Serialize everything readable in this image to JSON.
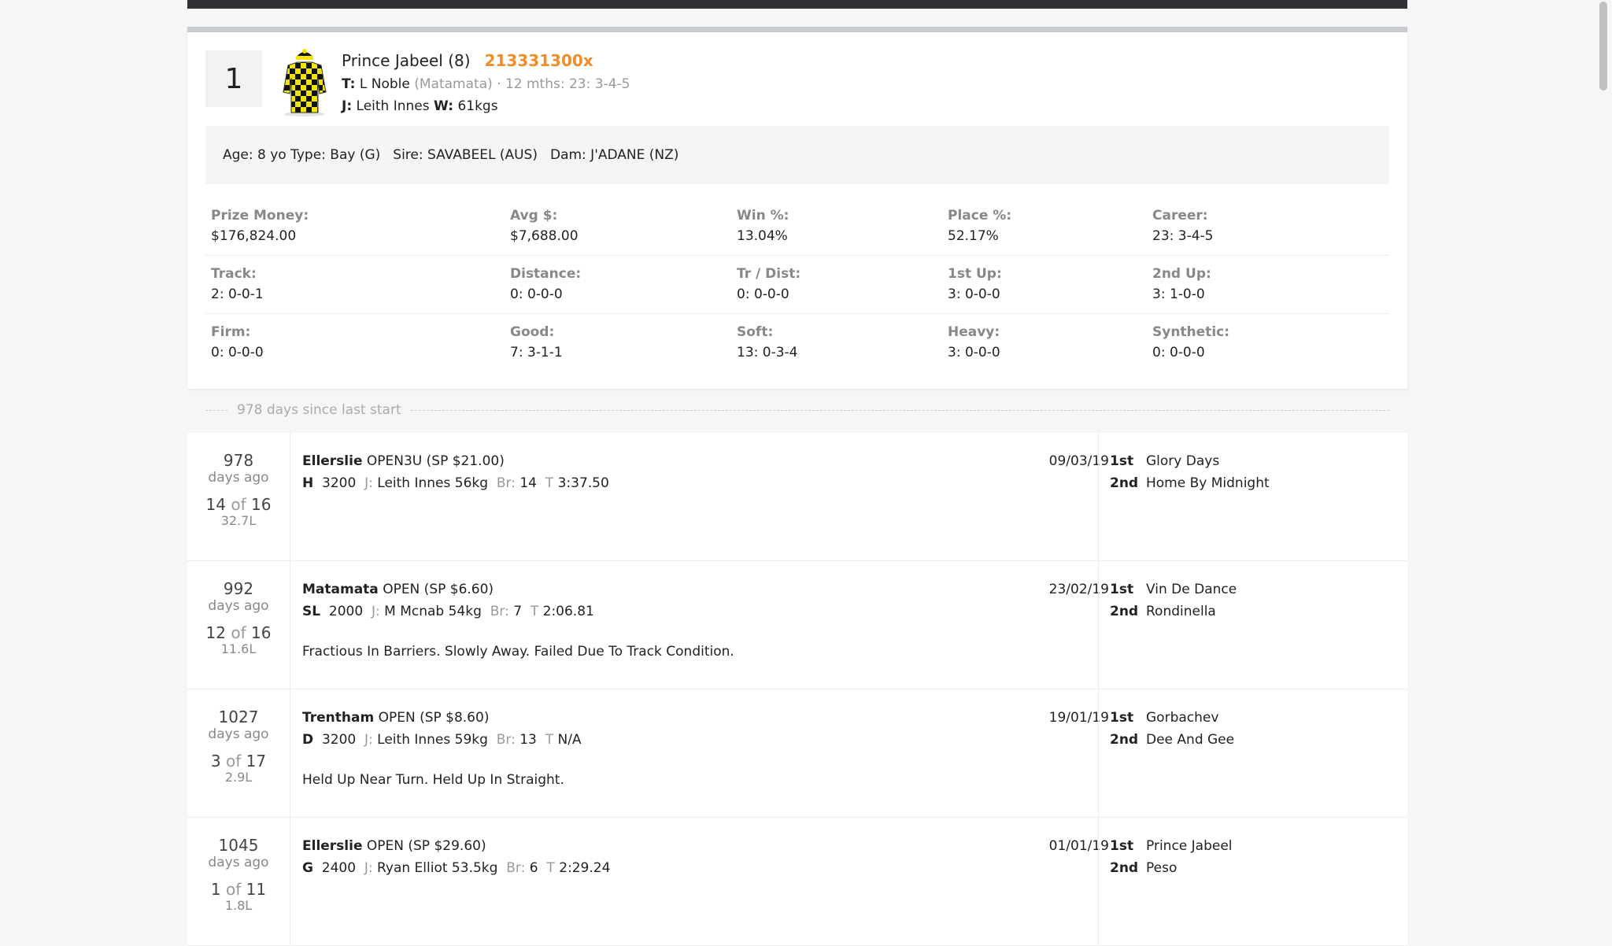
{
  "runner": {
    "number": "1",
    "name": "Prince Jabeel (8)",
    "form": "213331300x",
    "trainer_prefix": "T:",
    "trainer": "L Noble",
    "trainer_location": "(Matamata)",
    "trainer_stats": "· 12 mths: 23: 3-4-5",
    "jockey_prefix": "J:",
    "jockey": "Leith Innes",
    "weight_prefix": "W:",
    "weight": "61kgs"
  },
  "details": {
    "age": "Age: 8 yo",
    "type": "Type: Bay (G)",
    "sire": "Sire: SAVABEEL (AUS)",
    "dam": "Dam: J'ADANE (NZ)"
  },
  "stats": [
    [
      {
        "label": "Prize Money:",
        "value": "$176,824.00"
      },
      {
        "label": "Avg $:",
        "value": "$7,688.00"
      },
      {
        "label": "Win %:",
        "value": "13.04%"
      },
      {
        "label": "Place %:",
        "value": "52.17%"
      },
      {
        "label": "Career:",
        "value": "23: 3-4-5"
      }
    ],
    [
      {
        "label": "Track:",
        "value": "2: 0-0-1"
      },
      {
        "label": "Distance:",
        "value": "0: 0-0-0"
      },
      {
        "label": "Tr / Dist:",
        "value": "0: 0-0-0"
      },
      {
        "label": "1st Up:",
        "value": "3: 0-0-0"
      },
      {
        "label": "2nd Up:",
        "value": "3: 1-0-0"
      }
    ],
    [
      {
        "label": "Firm:",
        "value": "0: 0-0-0"
      },
      {
        "label": "Good:",
        "value": "7: 3-1-1"
      },
      {
        "label": "Soft:",
        "value": "13: 0-3-4"
      },
      {
        "label": "Heavy:",
        "value": "3: 0-0-0"
      },
      {
        "label": "Synthetic:",
        "value": "0: 0-0-0"
      }
    ]
  ],
  "divider_text": "978 days since last start",
  "runs": [
    {
      "days": "978",
      "days_ago": "days ago",
      "position": "14",
      "of": "of",
      "field": "16",
      "margin": "32.7L",
      "track": "Ellerslie",
      "race": "OPEN3U (SP $21.00)",
      "condition": "H",
      "distance": "3200",
      "jockey_prefix": "J:",
      "jockey": "Leith Innes 56kg",
      "barrier_prefix": "Br:",
      "barrier": "14",
      "time_prefix": "T",
      "time": "3:37.50",
      "comment": "",
      "date": "09/03/19",
      "first_label": "1st",
      "first": "Glory Days",
      "second_label": "2nd",
      "second": "Home By Midnight"
    },
    {
      "days": "992",
      "days_ago": "days ago",
      "position": "12",
      "of": "of",
      "field": "16",
      "margin": "11.6L",
      "track": "Matamata",
      "race": "OPEN (SP $6.60)",
      "condition": "SL",
      "distance": "2000",
      "jockey_prefix": "J:",
      "jockey": "M Mcnab 54kg",
      "barrier_prefix": "Br:",
      "barrier": "7",
      "time_prefix": "T",
      "time": "2:06.81",
      "comment": "Fractious In Barriers. Slowly Away. Failed Due To Track Condition.",
      "date": "23/02/19",
      "first_label": "1st",
      "first": "Vin De Dance",
      "second_label": "2nd",
      "second": "Rondinella"
    },
    {
      "days": "1027",
      "days_ago": "days ago",
      "position": "3",
      "of": "of",
      "field": "17",
      "margin": "2.9L",
      "track": "Trentham",
      "race": "OPEN (SP $8.60)",
      "condition": "D",
      "distance": "3200",
      "jockey_prefix": "J:",
      "jockey": "Leith Innes 59kg",
      "barrier_prefix": "Br:",
      "barrier": "13",
      "time_prefix": "T",
      "time": "N/A",
      "comment": "Held Up Near Turn. Held Up In Straight.",
      "date": "19/01/19",
      "first_label": "1st",
      "first": "Gorbachev",
      "second_label": "2nd",
      "second": "Dee And Gee"
    },
    {
      "days": "1045",
      "days_ago": "days ago",
      "position": "1",
      "of": "of",
      "field": "11",
      "margin": "1.8L",
      "track": "Ellerslie",
      "race": "OPEN (SP $29.60)",
      "condition": "G",
      "distance": "2400",
      "jockey_prefix": "J:",
      "jockey": "Ryan Elliot 53.5kg",
      "barrier_prefix": "Br:",
      "barrier": "6",
      "time_prefix": "T",
      "time": "2:29.24",
      "comment": "",
      "date": "01/01/19",
      "first_label": "1st",
      "first": "Prince Jabeel",
      "second_label": "2nd",
      "second": "Peso"
    }
  ],
  "colors": {
    "form": "#f28c28",
    "silks_primary": "#f2e600",
    "silks_secondary": "#111111"
  },
  "icons": {
    "silks": "jockey-silks-icon"
  }
}
